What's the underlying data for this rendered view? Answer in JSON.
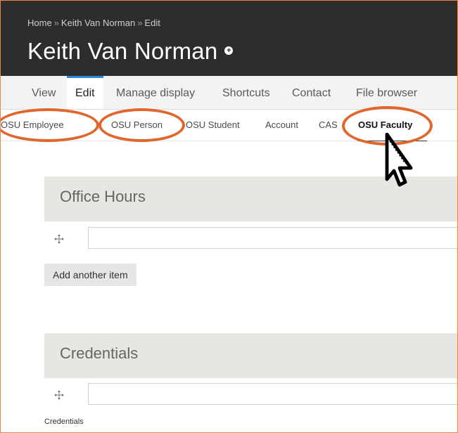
{
  "breadcrumb": {
    "home": "Home",
    "person": "Keith Van Norman",
    "current": "Edit",
    "separator": "»"
  },
  "page": {
    "title": "Keith Van Norman",
    "title_icon": "plus-circle-icon"
  },
  "primary_tabs": [
    {
      "label": "View"
    },
    {
      "label": "Edit",
      "active": true
    },
    {
      "label": "Manage display"
    },
    {
      "label": "Shortcuts"
    },
    {
      "label": "Contact"
    },
    {
      "label": "File browser"
    }
  ],
  "secondary_tabs": [
    {
      "label": "OSU Employee",
      "highlighted": true
    },
    {
      "label": "OSU Person",
      "highlighted": true
    },
    {
      "label": "OSU Student"
    },
    {
      "label": "Account"
    },
    {
      "label": "CAS"
    },
    {
      "label": "OSU Faculty",
      "active": true,
      "highlighted": true
    }
  ],
  "sections": {
    "office_hours": {
      "title": "Office Hours",
      "input_value": "",
      "add_label": "Add another item"
    },
    "credentials": {
      "title": "Credentials",
      "input_value": "",
      "description": "Credentials"
    }
  },
  "colors": {
    "header_bg": "#2d2d2d",
    "active_tab_border": "#2a8bd6",
    "highlight_ring": "#e1662c",
    "section_bg": "#e7e6e1"
  }
}
